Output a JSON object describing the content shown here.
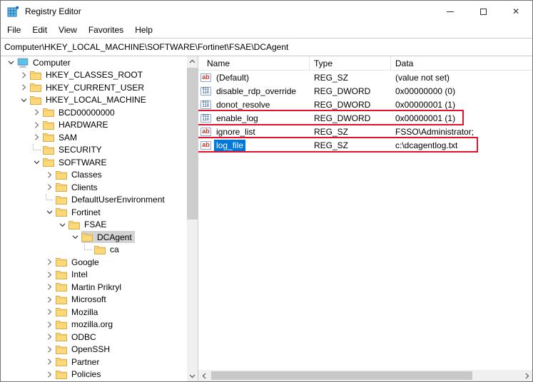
{
  "window": {
    "title": "Registry Editor"
  },
  "menu": {
    "items": [
      "File",
      "Edit",
      "View",
      "Favorites",
      "Help"
    ]
  },
  "address_bar": {
    "value": "Computer\\HKEY_LOCAL_MACHINE\\SOFTWARE\\Fortinet\\FSAE\\DCAgent"
  },
  "tree": {
    "items": [
      {
        "label": "Computer",
        "level": 0,
        "expander": "expanded",
        "icon": "computer-icon"
      },
      {
        "label": "HKEY_CLASSES_ROOT",
        "level": 1,
        "expander": "collapsed",
        "icon": "folder-icon"
      },
      {
        "label": "HKEY_CURRENT_USER",
        "level": 1,
        "expander": "collapsed",
        "icon": "folder-icon"
      },
      {
        "label": "HKEY_LOCAL_MACHINE",
        "level": 1,
        "expander": "expanded",
        "icon": "folder-icon"
      },
      {
        "label": "BCD00000000",
        "level": 2,
        "expander": "collapsed",
        "icon": "folder-icon"
      },
      {
        "label": "HARDWARE",
        "level": 2,
        "expander": "collapsed",
        "icon": "folder-icon"
      },
      {
        "label": "SAM",
        "level": 2,
        "expander": "collapsed",
        "icon": "folder-icon"
      },
      {
        "label": "SECURITY",
        "level": 2,
        "expander": "dotted",
        "icon": "folder-icon"
      },
      {
        "label": "SOFTWARE",
        "level": 2,
        "expander": "expanded",
        "icon": "folder-icon"
      },
      {
        "label": "Classes",
        "level": 3,
        "expander": "collapsed",
        "icon": "folder-icon"
      },
      {
        "label": "Clients",
        "level": 3,
        "expander": "collapsed",
        "icon": "folder-icon"
      },
      {
        "label": "DefaultUserEnvironment",
        "level": 3,
        "expander": "dotted",
        "icon": "folder-icon"
      },
      {
        "label": "Fortinet",
        "level": 3,
        "expander": "expanded",
        "icon": "folder-icon"
      },
      {
        "label": "FSAE",
        "level": 4,
        "expander": "expanded",
        "icon": "folder-icon"
      },
      {
        "label": "DCAgent",
        "level": 5,
        "expander": "expanded",
        "icon": "folder-icon",
        "selected": true
      },
      {
        "label": "ca",
        "level": 6,
        "expander": "dotted",
        "icon": "folder-icon"
      },
      {
        "label": "Google",
        "level": 3,
        "expander": "collapsed",
        "icon": "folder-icon"
      },
      {
        "label": "Intel",
        "level": 3,
        "expander": "collapsed",
        "icon": "folder-icon"
      },
      {
        "label": "Martin Prikryl",
        "level": 3,
        "expander": "collapsed",
        "icon": "folder-icon"
      },
      {
        "label": "Microsoft",
        "level": 3,
        "expander": "collapsed",
        "icon": "folder-icon"
      },
      {
        "label": "Mozilla",
        "level": 3,
        "expander": "collapsed",
        "icon": "folder-icon"
      },
      {
        "label": "mozilla.org",
        "level": 3,
        "expander": "collapsed",
        "icon": "folder-icon"
      },
      {
        "label": "ODBC",
        "level": 3,
        "expander": "collapsed",
        "icon": "folder-icon"
      },
      {
        "label": "OpenSSH",
        "level": 3,
        "expander": "collapsed",
        "icon": "folder-icon"
      },
      {
        "label": "Partner",
        "level": 3,
        "expander": "collapsed",
        "icon": "folder-icon"
      },
      {
        "label": "Policies",
        "level": 3,
        "expander": "collapsed",
        "icon": "folder-icon"
      }
    ]
  },
  "list": {
    "columns": [
      "Name",
      "Type",
      "Data"
    ],
    "rows": [
      {
        "name": "(Default)",
        "type": "REG_SZ",
        "data": "(value not set)",
        "icon": "string-icon"
      },
      {
        "name": "disable_rdp_override",
        "type": "REG_DWORD",
        "data": "0x00000000 (0)",
        "icon": "dword-icon"
      },
      {
        "name": "donot_resolve",
        "type": "REG_DWORD",
        "data": "0x00000001 (1)",
        "icon": "dword-icon"
      },
      {
        "name": "enable_log",
        "type": "REG_DWORD",
        "data": "0x00000001 (1)",
        "icon": "dword-icon",
        "highlight_box": true
      },
      {
        "name": "ignore_list",
        "type": "REG_SZ",
        "data": "FSSO\\Administrator;",
        "icon": "string-icon"
      },
      {
        "name": "log_file",
        "type": "REG_SZ",
        "data": "c:\\dcagentlog.txt",
        "icon": "string-icon",
        "name_selected": true,
        "highlight_box": true
      }
    ],
    "dword_icon_lines": [
      "011",
      "110"
    ],
    "string_icon_text": "ab"
  },
  "colors": {
    "accent_selection": "#0078d7",
    "inactive_selection": "#d3d3d3",
    "highlight_box_red": "#e8112d",
    "folder_yellow": "#fbd978"
  }
}
